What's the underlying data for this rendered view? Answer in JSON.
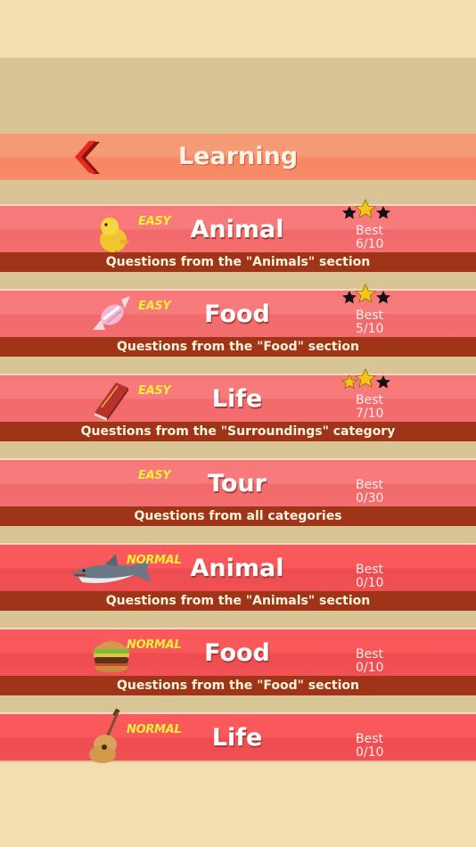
{
  "header": {
    "title": "Learning"
  },
  "colors": {
    "easy_level": "#ffee3a",
    "caption_bar": "#9f3418",
    "header": "#f49a74"
  },
  "rows": [
    {
      "level": "EASY",
      "title": "Animal",
      "best_label": "Best",
      "best_score": "6/10",
      "caption": "Questions from the \"Animals\" section",
      "stars_earned": 1,
      "icon": "chick-icon"
    },
    {
      "level": "EASY",
      "title": "Food",
      "best_label": "Best",
      "best_score": "5/10",
      "caption": "Questions from the \"Food\" section",
      "stars_earned": 1,
      "icon": "candy-icon"
    },
    {
      "level": "EASY",
      "title": "Life",
      "best_label": "Best",
      "best_score": "7/10",
      "caption": "Questions from the \"Surroundings\" category",
      "stars_earned": 2,
      "icon": "book-icon"
    },
    {
      "level": "EASY",
      "title": "Tour",
      "best_label": "Best",
      "best_score": "0/30",
      "caption": "Questions from all categories"
    },
    {
      "level": "NORMAL",
      "title": "Animal",
      "best_label": "Best",
      "best_score": "0/10",
      "caption": "Questions from the \"Animals\" section",
      "icon": "shark-icon"
    },
    {
      "level": "NORMAL",
      "title": "Food",
      "best_label": "Best",
      "best_score": "0/10",
      "caption": "Questions from the \"Food\" section",
      "icon": "burger-icon"
    },
    {
      "level": "NORMAL",
      "title": "Life",
      "best_label": "Best",
      "best_score": "0/10",
      "icon": "guitar-icon"
    }
  ]
}
